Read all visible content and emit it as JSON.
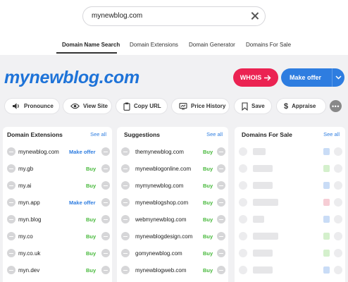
{
  "search": {
    "value": "mynewblog.com"
  },
  "tabs": [
    {
      "label": "Domain Name Search",
      "active": true
    },
    {
      "label": "Domain Extensions"
    },
    {
      "label": "Domain Generator"
    },
    {
      "label": "Domains For Sale"
    }
  ],
  "domain": {
    "title": "mynewblog.com"
  },
  "buttons": {
    "whois": "WHOIS",
    "make_offer": "Make offer"
  },
  "actions": [
    {
      "label": "Pronounce",
      "icon": "speaker-icon"
    },
    {
      "label": "View Site",
      "icon": "eye-icon"
    },
    {
      "label": "Copy URL",
      "icon": "clipboard-icon"
    },
    {
      "label": "Price History",
      "icon": "price-tag-icon"
    },
    {
      "label": "Save",
      "icon": "bookmark-icon"
    },
    {
      "label": "Appraise",
      "icon": "dollar-icon"
    }
  ],
  "panels": {
    "extensions": {
      "title": "Domain Extensions",
      "see_all": "See all",
      "rows": [
        {
          "name": "mynewblog.com",
          "status": "Make offer"
        },
        {
          "name": "my.gb",
          "status": "Buy"
        },
        {
          "name": "my.ai",
          "status": "Buy"
        },
        {
          "name": "myn.app",
          "status": "Make offer"
        },
        {
          "name": "myn.blog",
          "status": "Buy"
        },
        {
          "name": "my.co",
          "status": "Buy"
        },
        {
          "name": "my.co.uk",
          "status": "Buy"
        },
        {
          "name": "myn.dev",
          "status": "Buy"
        }
      ]
    },
    "suggestions": {
      "title": "Suggestions",
      "see_all": "See all",
      "rows": [
        {
          "name": "themynewblog.com",
          "status": "Buy"
        },
        {
          "name": "mynewblogonline.com",
          "status": "Buy"
        },
        {
          "name": "mymynewblog.com",
          "status": "Buy"
        },
        {
          "name": "mynewblogshop.com",
          "status": "Buy"
        },
        {
          "name": "webmynewblog.com",
          "status": "Buy"
        },
        {
          "name": "mynewblogdesign.com",
          "status": "Buy"
        },
        {
          "name": "gomynewblog.com",
          "status": "Buy"
        },
        {
          "name": "mynewblogweb.com",
          "status": "Buy"
        }
      ]
    },
    "for_sale": {
      "title": "Domains For Sale",
      "see_all": "See all",
      "placeholder_colors": [
        "#c9dcf6",
        "#d4f0cc",
        "#c9dcf6",
        "#f6cdd5",
        "#c9dcf6",
        "#d4f0cc",
        "#d4f0cc",
        "#c9dcf6"
      ]
    }
  },
  "colors": {
    "brand_blue": "#1e73d8",
    "whois_red": "#eb2352",
    "buy_green": "#46b83a"
  }
}
